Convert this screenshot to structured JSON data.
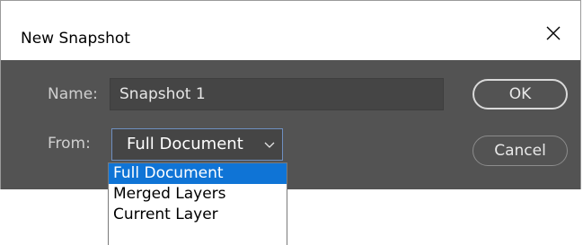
{
  "dialog": {
    "title": "New Snapshot",
    "close_icon": "close-icon"
  },
  "form": {
    "name_label": "Name:",
    "name_value": "Snapshot 1",
    "from_label": "From:",
    "from_selected": "Full Document",
    "from_chevron_icon": "chevron-down-icon"
  },
  "buttons": {
    "ok_label": "OK",
    "cancel_label": "Cancel"
  },
  "dropdown": {
    "options": [
      "Full Document",
      "Merged Layers",
      "Current Layer"
    ],
    "highlighted_index": 0
  },
  "colors": {
    "dialog_bg": "#535353",
    "highlight": "#0f74d6"
  }
}
